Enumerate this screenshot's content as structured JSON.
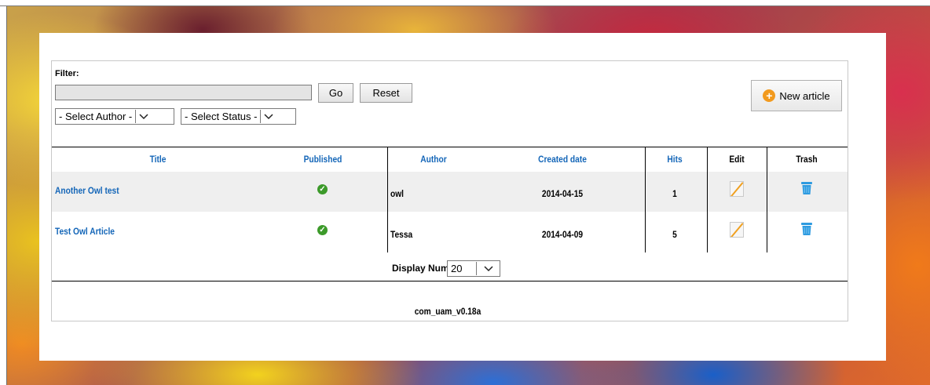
{
  "filter": {
    "label": "Filter:",
    "input_value": "",
    "go_label": "Go",
    "reset_label": "Reset",
    "author_select": "- Select Author -",
    "status_select": "- Select Status -"
  },
  "new_article_label": "New article",
  "table": {
    "headers": {
      "title": "Title",
      "published": "Published",
      "author": "Author",
      "created": "Created date",
      "hits": "Hits",
      "edit": "Edit",
      "trash": "Trash"
    },
    "rows": [
      {
        "title": "Another Owl test",
        "published": true,
        "author": "owl",
        "created": "2014-04-15",
        "hits": "1"
      },
      {
        "title": "Test Owl Article",
        "published": true,
        "author": "Tessa",
        "created": "2014-04-09",
        "hits": "5"
      }
    ]
  },
  "pagination": {
    "label": "Display Num",
    "value": "20"
  },
  "footer": "com_uam_v0.18a",
  "colors": {
    "link": "#1466b8",
    "published_icon": "#3c9a2a",
    "new_icon": "#f29a1e",
    "trash_icon": "#2e9be0"
  },
  "icons": {
    "published": "check-circle-icon",
    "edit": "pencil-icon",
    "trash": "trash-icon",
    "new": "plus-circle-icon",
    "dropdown": "chevron-down-icon"
  }
}
